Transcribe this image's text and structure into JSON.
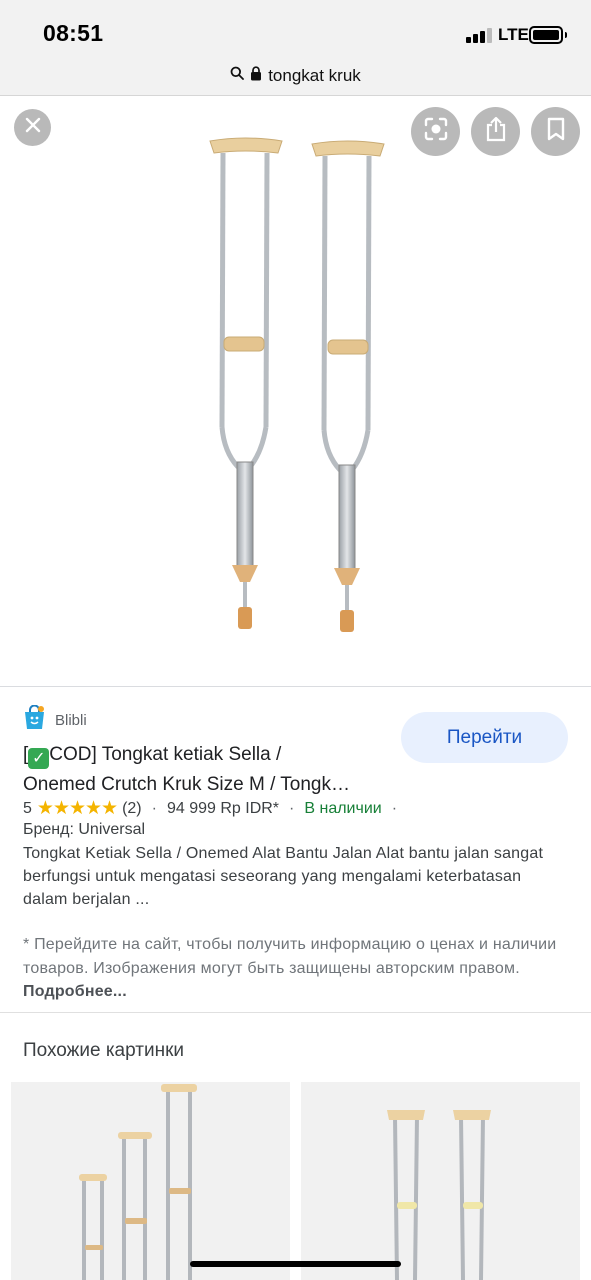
{
  "status_bar": {
    "time": "08:51",
    "network": "LTE",
    "icons": [
      "signal-icon",
      "battery-icon"
    ]
  },
  "address_bar": {
    "url": "tongkat kruk",
    "icons": [
      "search-icon",
      "lock-icon"
    ]
  },
  "viewer": {
    "buttons": [
      "close-icon",
      "lens-icon",
      "share-icon",
      "bookmark-icon"
    ]
  },
  "result": {
    "source": "Blibli",
    "go_label": "Перейти",
    "title_line1_prefix": "[",
    "title_line1_rest": "COD] Tongkat ketiak Sella /",
    "title_line2": "Onemed Crutch Kruk Size M / Tongk…",
    "rating": "5",
    "stars": "★★★★★",
    "reviews": "(2)",
    "price": "94 999 Rp IDR*",
    "availability": "В наличии",
    "separator": "·",
    "brand": "Бренд: Universal",
    "description": "Tongkat Ketiak Sella / Onemed Alat Bantu Jalan Alat bantu jalan sangat berfungsi untuk mengatasi seseorang yang mengalami keterbatasan dalam berjalan ...",
    "disclaimer": "* Перейдите на сайт, чтобы получить информацию о ценах и наличии товаров. Изображения могут быть защищены авторским правом.",
    "more_label": "Подробнее..."
  },
  "similar": {
    "title": "Похожие картинки"
  },
  "colors": {
    "accent": "#1a56c4",
    "accent_bg": "#e8f0fe",
    "star": "#f4b400",
    "in_stock": "#188038"
  }
}
